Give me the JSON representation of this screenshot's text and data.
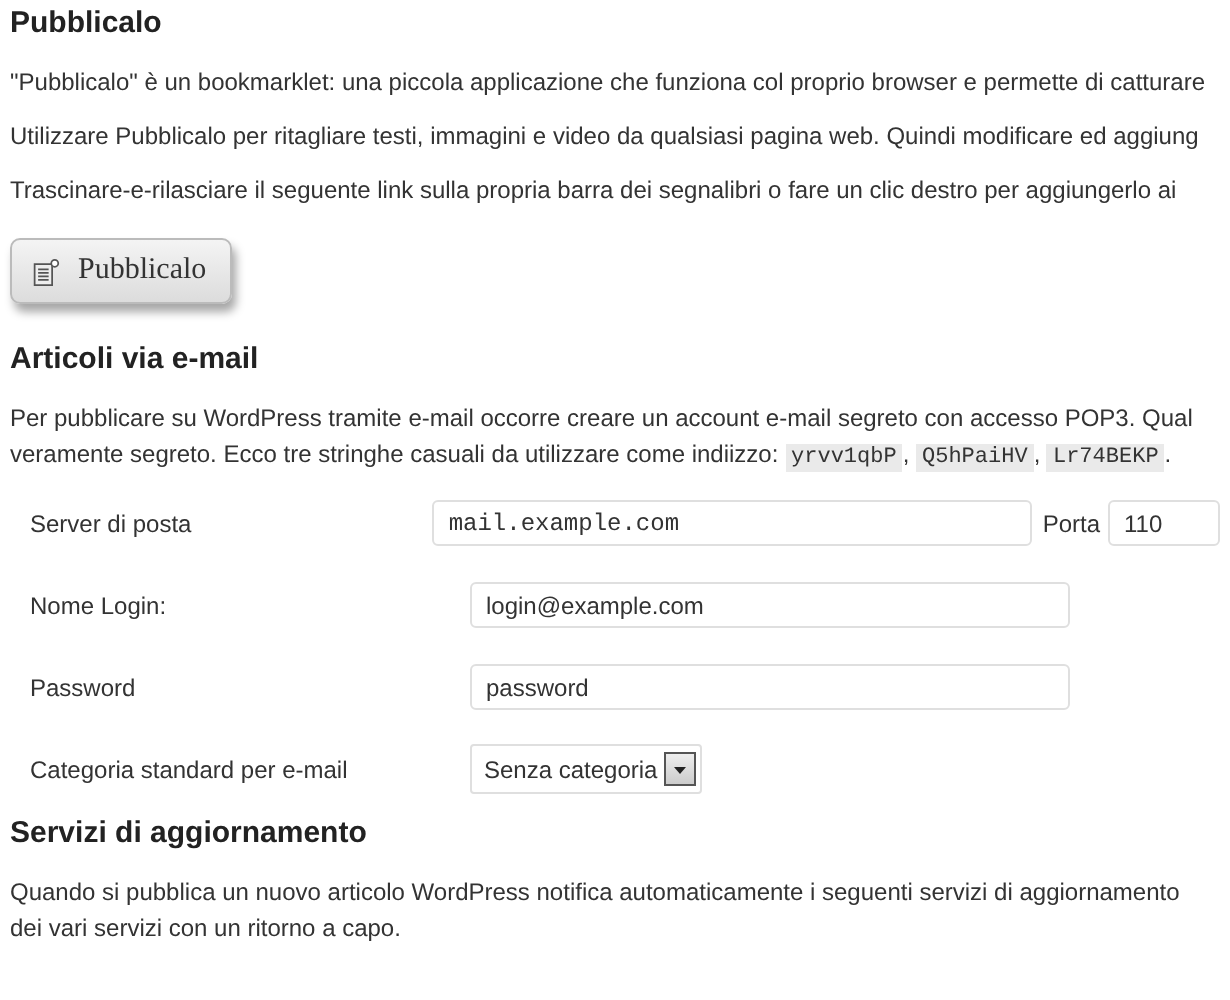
{
  "sections": [
    {
      "heading": "Pubblicalo",
      "paragraphs": [
        "\"Pubblicalo\" è un bookmarklet: una piccola applicazione che funziona col proprio browser e permette di catturare",
        "Utilizzare Pubblicalo per ritagliare testi, immagini e video da qualsiasi pagina web. Quindi modificare ed aggiung",
        "Trascinare-e-rilasciare il seguente link sulla propria barra dei segnalibri o fare un clic destro per aggiungerlo ai"
      ],
      "bookmarklet_button": "Pubblicalo"
    },
    {
      "heading": "Articoli via e-mail",
      "intro": [
        {
          "kind": "text",
          "text": "Per pubblicare su WordPress tramite e-mail occorre creare un account e-mail segreto con accesso POP3. Qual\nveramente segreto. Ecco tre stringhe casuali da utilizzare come indiizzo: "
        },
        {
          "kind": "code",
          "text": "yrvv1qbP"
        },
        {
          "kind": "text",
          "text": ", "
        },
        {
          "kind": "code",
          "text": "Q5hPaiHV"
        },
        {
          "kind": "text",
          "text": ", "
        },
        {
          "kind": "code",
          "text": "Lr74BEKP"
        },
        {
          "kind": "text",
          "text": "."
        }
      ],
      "fields": [
        {
          "label": "Server di posta",
          "kind": "text",
          "value": "mail.example.com",
          "mono": true,
          "extra_label": "Porta",
          "extra_value": "110"
        },
        {
          "label": "Nome Login:",
          "kind": "text",
          "value": "login@example.com",
          "mono": false
        },
        {
          "label": "Password",
          "kind": "text",
          "value": "password",
          "mono": false
        },
        {
          "label": "Categoria standard per e-mail",
          "kind": "select",
          "value": "Senza categoria"
        }
      ]
    },
    {
      "heading": "Servizi di aggiornamento",
      "paragraphs": [
        "Quando si pubblica un nuovo articolo WordPress notifica automaticamente i seguenti servizi di aggiornamento\ndei vari servizi con un ritorno a capo."
      ]
    }
  ]
}
